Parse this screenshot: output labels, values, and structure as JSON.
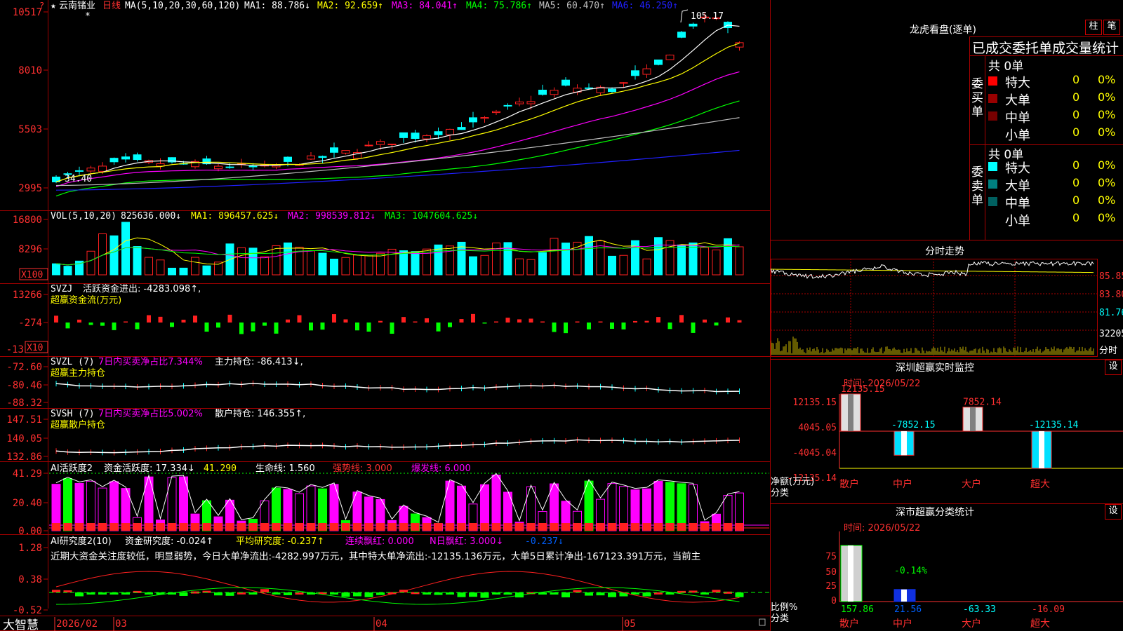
{
  "stock": {
    "name": "云南锗业",
    "period": "日线",
    "star_top": "★",
    "star2": "*"
  },
  "main_panel": {
    "legend": {
      "ma": "MA(5,10,20,30,60,120)",
      "ma1": "MA1: 88.786↓",
      "ma2": "MA2: 92.659↑",
      "ma3": "MA3: 84.041↑",
      "ma4": "MA4: 75.786↑",
      "ma5": "MA5: 60.470↑",
      "ma6": "MA6: 46.250↑"
    },
    "y_ticks": [
      "10517",
      "8010",
      "5503",
      "2995"
    ],
    "high_label": "105.17",
    "low_label": "34.40",
    "colors": {
      "ma1": "#ffffff",
      "ma2": "#ffff00",
      "ma3": "#ff00ff",
      "ma4": "#00ff00",
      "ma5": "#c0c0c0",
      "ma6": "#2020ff",
      "up": "#ff2020",
      "down": "#00ffff"
    }
  },
  "vol_panel": {
    "legend": {
      "name": "VOL(5,10,20)",
      "v": "825636.000↓",
      "ma1": "MA1: 896457.625↓",
      "ma2": "MA2: 998539.812↓",
      "ma3": "MA3: 1047604.625↓"
    },
    "y_ticks": [
      "16800",
      "8296"
    ],
    "unit": "X100"
  },
  "svzj_panel": {
    "legend": {
      "name": "SVZJ",
      "text": "活跃资金进出: -4283.098↑,",
      "sub": "超赢资金流(万元)"
    },
    "y_ticks": [
      "13266",
      "-274",
      "-13"
    ],
    "unit": "X10"
  },
  "svzl_panel": {
    "legend": {
      "name": "SVZL (7)",
      "ratio": "7日内买卖净占比7.344%",
      "hold": "主力持仓: -86.413↓,",
      "sub": "超赢主力持仓"
    },
    "y_ticks": [
      "-72.60",
      "-80.46",
      "-88.32"
    ]
  },
  "svsh_panel": {
    "legend": {
      "name": "SVSH (7)",
      "ratio": "7日内买卖净占比5.002%",
      "hold": "散户持仓: 146.355↑,",
      "sub": "超赢散户持仓"
    },
    "y_ticks": [
      "147.51",
      "140.05",
      "132.86"
    ]
  },
  "ai_active_panel": {
    "legend": {
      "name": "AI活跃度2",
      "a": "资金活跃度: 17.334↓",
      "b": "41.290",
      "c": "生命线: 1.560",
      "d": "强势线: 3.000",
      "e": "爆发线: 6.000"
    },
    "y_ticks": [
      "41.29",
      "20.40",
      "0.00"
    ]
  },
  "ai_research_panel": {
    "legend": {
      "name": "AI研究度2(10)",
      "a": "资金研究度: -0.024↑",
      "b": "平均研究度: -0.237↑",
      "c": "连续飘红: 0.000",
      "d": "N日飘红: 3.000↓",
      "e": "-0.237↓"
    },
    "commentary": "近期大资金关注度较低，明显弱势，今日大单净流出:-4282.997万元，其中特大单净流出:-12135.136万元，大单5日累计净出-167123.391万元，当前主",
    "y_ticks": [
      "1.28",
      "0.38",
      "-0.52"
    ]
  },
  "x_axis": {
    "brand": "大智慧",
    "labels": [
      "2026/02",
      "03",
      "04",
      "05"
    ]
  },
  "dragon_tiger": {
    "title": "龙虎看盘(逐单)",
    "buttons": [
      "柱",
      "笔"
    ],
    "header": "已成交委托单成交量统计",
    "buy_label": "委买单",
    "sell_label": "委卖单",
    "buy_total": "共 0单",
    "sell_total": "共 0单",
    "buy_rows": [
      {
        "name": "特大",
        "count": "0",
        "pct": "0%",
        "color": "#ff0000"
      },
      {
        "name": "大单",
        "count": "0",
        "pct": "0%",
        "color": "#990000"
      },
      {
        "name": "中单",
        "count": "0",
        "pct": "0%",
        "color": "#770000"
      },
      {
        "name": "小单",
        "count": "0",
        "pct": "0%",
        "color": ""
      }
    ],
    "sell_rows": [
      {
        "name": "特大",
        "count": "0",
        "pct": "0%",
        "color": "#00ffff"
      },
      {
        "name": "大单",
        "count": "0",
        "pct": "0%",
        "color": "#008080"
      },
      {
        "name": "中单",
        "count": "0",
        "pct": "0%",
        "color": "#006060"
      },
      {
        "name": "小单",
        "count": "0",
        "pct": "0%",
        "color": ""
      }
    ]
  },
  "intraday": {
    "title": "分时走势",
    "y_ticks": [
      "85.85",
      "83.80",
      "81.76",
      "32205"
    ],
    "label": "分时"
  },
  "sz_monitor": {
    "title": "深圳超赢实时监控",
    "button": "设",
    "time": "时间: 2026/05/22",
    "top_value": "12135.15",
    "y_ticks": [
      "12135.15",
      "4045.05",
      "-4045.04",
      "-12135.14"
    ],
    "y_label_1": "净额(万元)",
    "y_label_2": "分类",
    "categories": [
      "散户",
      "中户",
      "大户",
      "超大"
    ],
    "values": [
      12135.15,
      -7852.15,
      7852.14,
      -12135.14
    ],
    "value_labels": [
      "12135.15",
      "-7852.15",
      "7852.14",
      "-12135.14"
    ]
  },
  "sz_category": {
    "title": "深市超赢分类统计",
    "button": "设",
    "time": "时间: 2026/05/22",
    "y_ticks": [
      "75",
      "50",
      "25",
      "0"
    ],
    "y_label_1": "比例%",
    "y_label_2": "分类",
    "categories": [
      "散户",
      "中户",
      "大户",
      "超大"
    ],
    "bar_values": [
      100,
      21.56,
      0,
      0
    ],
    "bar_label": "-0.14%",
    "value_labels": [
      "157.86",
      "21.56",
      "-63.33",
      "-16.09"
    ],
    "value_colors": [
      "#00ff00",
      "#0060ff",
      "#00ffff",
      "#ff3030"
    ]
  },
  "chart_data": {
    "type": "candlestick",
    "series": [
      {
        "name": "MA1",
        "values": [
          34.4,
          35,
          36,
          37,
          38,
          40,
          40,
          39.5,
          39,
          38.5,
          38.5,
          38,
          38,
          38,
          38.5,
          39,
          40,
          42,
          44,
          46,
          46.5,
          47,
          48,
          50,
          52,
          54,
          57,
          62,
          67,
          72,
          76,
          78,
          78,
          76,
          75,
          76,
          79,
          85,
          92,
          99,
          104,
          102,
          99,
          97,
          95,
          92,
          88.786
        ]
      },
      {
        "name": "MA2",
        "values": [
          33,
          33.5,
          34,
          35,
          36,
          37,
          38,
          38.5,
          38.5,
          38.5,
          38.5,
          38.5,
          38.2,
          38.2,
          38.5,
          39,
          39.5,
          40.5,
          42,
          43.5,
          45,
          46.5,
          47.5,
          49,
          50.5,
          52,
          54,
          57,
          60,
          64,
          68,
          71,
          73,
          74,
          75,
          76,
          77,
          80,
          84,
          88,
          92,
          94,
          95,
          95,
          94,
          93.5,
          92.659
        ]
      },
      {
        "name": "MA3",
        "values": [
          32,
          32.5,
          33,
          33.5,
          34,
          35,
          35.5,
          36,
          36.5,
          37,
          37.5,
          37.5,
          37.8,
          37.8,
          38,
          38.2,
          38.5,
          39,
          40,
          41,
          42,
          43,
          44,
          45,
          46.5,
          48,
          50,
          52,
          54,
          56.5,
          59,
          61.5,
          64,
          66,
          68,
          70,
          71.5,
          73,
          75,
          77,
          79,
          80.5,
          81.5,
          82.5,
          83,
          83.5,
          84.041
        ]
      }
    ]
  }
}
